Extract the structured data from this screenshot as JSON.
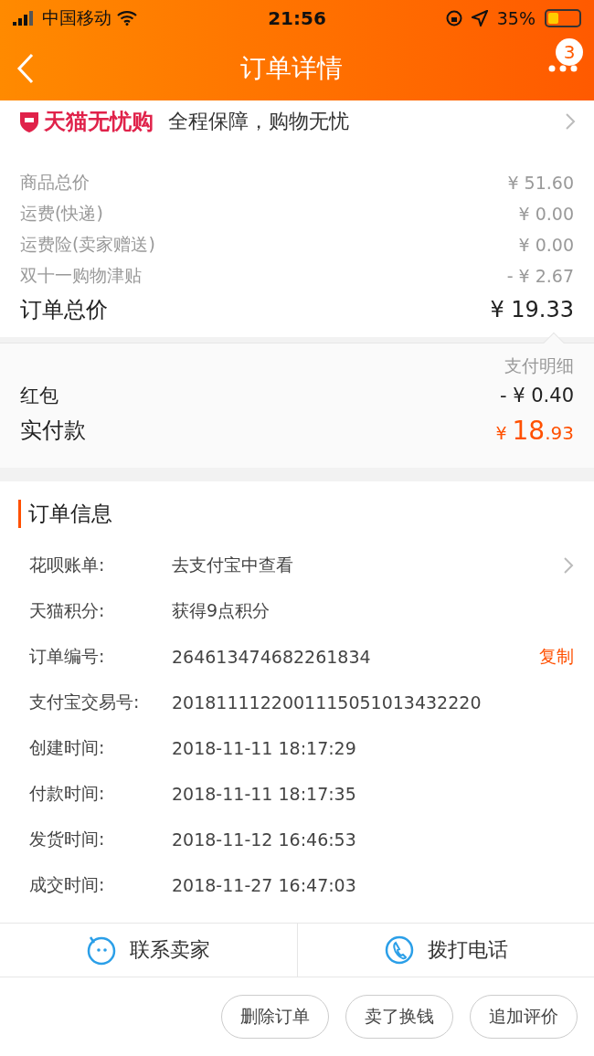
{
  "status_bar": {
    "carrier": "中国移动",
    "time": "21:56",
    "battery_text": "35%"
  },
  "nav": {
    "title": "订单详情",
    "badge": "3"
  },
  "guarantee": {
    "brand": "天猫无忧购",
    "text": "全程保障，购物无忧"
  },
  "price_lines": [
    {
      "label": "商品总价",
      "value": "¥ 51.60",
      "kind": "minor"
    },
    {
      "label": "运费(快递)",
      "value": "¥ 0.00",
      "kind": "minor"
    },
    {
      "label": "运费险(卖家赠送)",
      "value": "¥ 0.00",
      "kind": "minor"
    },
    {
      "label": "双十一购物津贴",
      "value": "- ¥ 2.67",
      "kind": "minor"
    },
    {
      "label": "订单总价",
      "value": "¥ 19.33",
      "kind": "total"
    }
  ],
  "payment": {
    "detail_link": "支付明细",
    "lines": [
      {
        "label": "红包",
        "value": "- ¥ 0.40"
      }
    ],
    "paid_label": "实付款",
    "paid_currency": "¥",
    "paid_integer": "18",
    "paid_decimal": ".93"
  },
  "order_info": {
    "title": "订单信息",
    "rows": [
      {
        "label": "花呗账单:",
        "value": "去支付宝中查看",
        "kind": "link"
      },
      {
        "label": "天猫积分:",
        "value": "获得9点积分",
        "kind": "plain"
      },
      {
        "label": "订单编号:",
        "value": "264613474682261834",
        "kind": "copy",
        "action": "复制"
      },
      {
        "label": "支付宝交易号:",
        "value": "2018111122001115051013432220",
        "kind": "plain"
      },
      {
        "label": "创建时间:",
        "value": "2018-11-11 18:17:29",
        "kind": "plain"
      },
      {
        "label": "付款时间:",
        "value": "2018-11-11 18:17:35",
        "kind": "plain"
      },
      {
        "label": "发货时间:",
        "value": "2018-11-12 16:46:53",
        "kind": "plain"
      },
      {
        "label": "成交时间:",
        "value": "2018-11-27 16:47:03",
        "kind": "plain"
      }
    ]
  },
  "contact": [
    {
      "label": "联系卖家",
      "kind": "chat"
    },
    {
      "label": "拨打电话",
      "kind": "phone"
    }
  ],
  "actions": [
    "删除订单",
    "卖了换钱",
    "追加评价"
  ]
}
